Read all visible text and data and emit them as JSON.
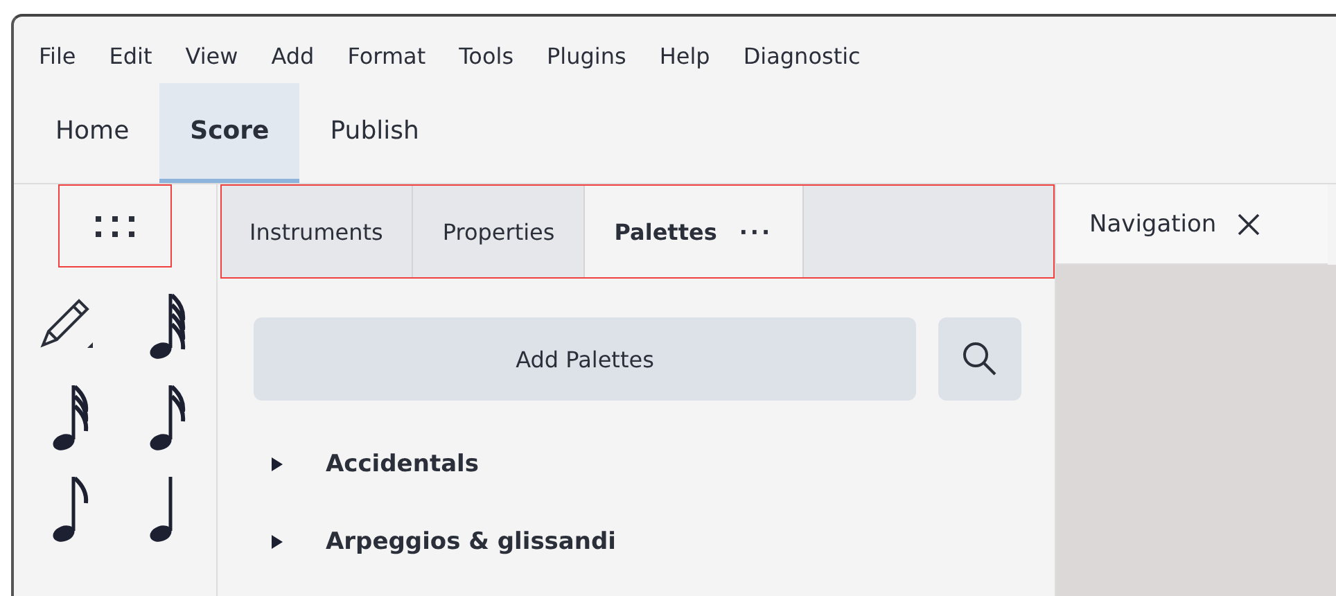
{
  "menu": [
    {
      "label": "File"
    },
    {
      "label": "Edit"
    },
    {
      "label": "View"
    },
    {
      "label": "Add"
    },
    {
      "label": "Format"
    },
    {
      "label": "Tools"
    },
    {
      "label": "Plugins"
    },
    {
      "label": "Help"
    },
    {
      "label": "Diagnostic"
    }
  ],
  "ribbon_tabs": [
    {
      "label": "Home",
      "selected": false
    },
    {
      "label": "Score",
      "selected": true
    },
    {
      "label": "Publish",
      "selected": false
    }
  ],
  "tools": [
    {
      "kind": "pencil"
    },
    {
      "kind": "note64"
    },
    {
      "kind": "note32"
    },
    {
      "kind": "note16"
    },
    {
      "kind": "note8"
    },
    {
      "kind": "note4"
    }
  ],
  "panel_tabs": [
    {
      "label": "Instruments",
      "selected": false
    },
    {
      "label": "Properties",
      "selected": false
    },
    {
      "label": "Palettes",
      "selected": true,
      "menu": "···"
    }
  ],
  "add_button": "Add Palettes",
  "palettes": [
    {
      "label": "Accidentals",
      "expanded": false
    },
    {
      "label": "Arpeggios & glissandi",
      "expanded": false
    }
  ],
  "navigation": {
    "title": "Navigation"
  }
}
